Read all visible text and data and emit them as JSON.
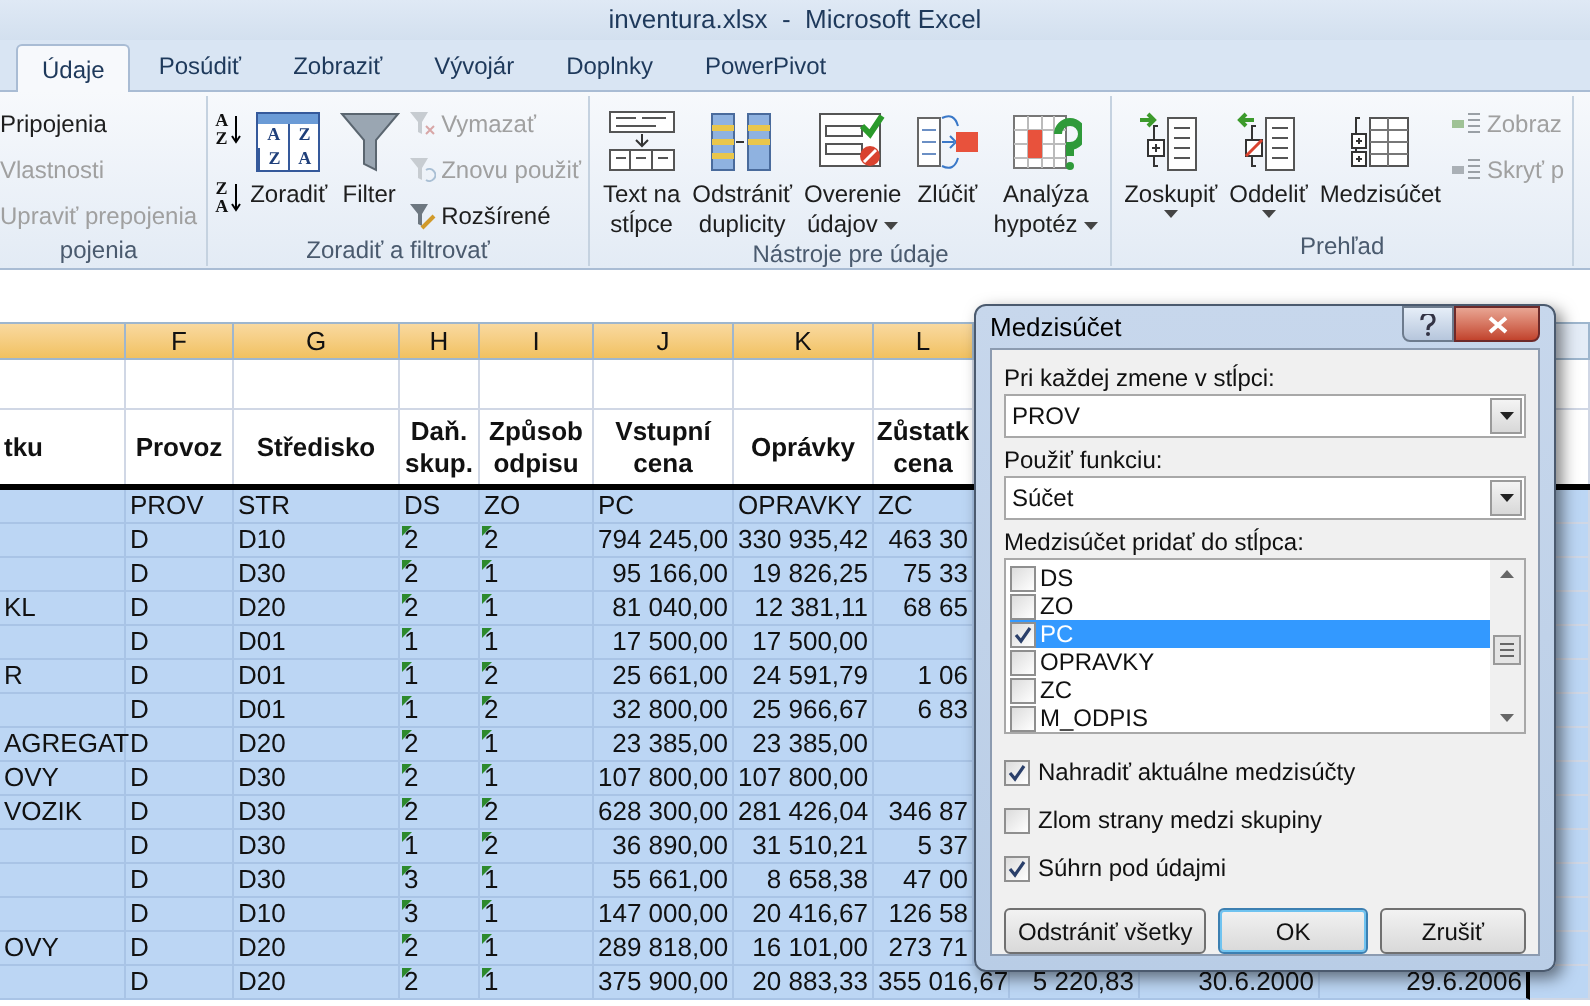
{
  "window": {
    "title": "inventura.xlsx  -  Microsoft Excel"
  },
  "tabs": [
    {
      "label": "Údaje",
      "selected": true
    },
    {
      "label": "Posúdiť",
      "selected": false
    },
    {
      "label": "Zobraziť",
      "selected": false
    },
    {
      "label": "Vývojár",
      "selected": false
    },
    {
      "label": "Doplnky",
      "selected": false
    },
    {
      "label": "PowerPivot",
      "selected": false
    }
  ],
  "ribbon": {
    "groups": [
      {
        "label": "pojenia",
        "items": [
          {
            "kind": "small",
            "label": "Pripojenia",
            "disabled": false
          },
          {
            "kind": "small",
            "label": "Vlastnosti",
            "disabled": true
          },
          {
            "kind": "small",
            "label": "Upraviť prepojenia",
            "disabled": true
          }
        ]
      },
      {
        "label": "Zoradiť a filtrovať",
        "items": [
          {
            "kind": "sort",
            "letters": [
              "A",
              "Z"
            ]
          },
          {
            "kind": "sort",
            "letters": [
              "Z",
              "A"
            ]
          },
          {
            "kind": "large",
            "lines": [
              "Zoradiť"
            ],
            "letters": [
              "A",
              "Z",
              "Z",
              "A"
            ],
            "dropdown": false
          },
          {
            "kind": "large",
            "lines": [
              "Filter"
            ],
            "dropdown": false
          },
          {
            "kind": "small",
            "label": "Vymazať",
            "disabled": true
          },
          {
            "kind": "small",
            "label": "Znovu použiť",
            "disabled": true
          },
          {
            "kind": "small",
            "label": "Rozšírené",
            "disabled": false
          }
        ]
      },
      {
        "label": "Nástroje pre údaje",
        "items": [
          {
            "kind": "large",
            "lines": [
              "Text na",
              "stĺpce"
            ],
            "dropdown": false
          },
          {
            "kind": "large",
            "lines": [
              "Odstrániť",
              "duplicity"
            ],
            "dropdown": false
          },
          {
            "kind": "large",
            "lines": [
              "Overenie",
              "údajov"
            ],
            "dropdown": true
          },
          {
            "kind": "large",
            "lines": [
              "Zlúčiť"
            ],
            "dropdown": false
          },
          {
            "kind": "large",
            "lines": [
              "Analýza",
              "hypotéz"
            ],
            "dropdown": true
          }
        ]
      },
      {
        "label": "Prehľad",
        "items": [
          {
            "kind": "large",
            "lines": [
              "Zoskupiť"
            ],
            "dropdown": true
          },
          {
            "kind": "large",
            "lines": [
              "Oddeliť"
            ],
            "dropdown": true
          },
          {
            "kind": "large",
            "lines": [
              "Medzisúčet"
            ],
            "dropdown": false
          },
          {
            "kind": "small",
            "label": "Zobraz",
            "disabled": true
          },
          {
            "kind": "small",
            "label": "Skryť p",
            "disabled": true
          }
        ]
      }
    ]
  },
  "sheet": {
    "column_letters": [
      "F",
      "G",
      "H",
      "I",
      "J",
      "K",
      "L"
    ],
    "header": [
      "tku",
      "Provoz",
      "Středisko",
      "Daň. skup.",
      "Způsob odpisu",
      "Vstupní cena",
      "Oprávky",
      "Zůstatk cena"
    ],
    "rows": [
      {
        "selected": true,
        "cells": [
          "",
          "PROV",
          "STR",
          "DS",
          "ZO",
          "PC",
          "OPRAVKY",
          "ZC"
        ]
      },
      {
        "selected": true,
        "cells": [
          "",
          "D",
          "D10",
          "2",
          "2",
          "794 245,00",
          "330 935,42",
          "463 30"
        ]
      },
      {
        "selected": true,
        "cells": [
          "",
          "D",
          "D30",
          "2",
          "1",
          "95 166,00",
          "19 826,25",
          "75 33"
        ]
      },
      {
        "selected": true,
        "cells": [
          "KL",
          "D",
          "D20",
          "2",
          "1",
          "81 040,00",
          "12 381,11",
          "68 65"
        ]
      },
      {
        "selected": true,
        "cells": [
          "",
          "D",
          "D01",
          "1",
          "1",
          "17 500,00",
          "17 500,00",
          ""
        ]
      },
      {
        "selected": true,
        "cells": [
          "R",
          "D",
          "D01",
          "1",
          "2",
          "25 661,00",
          "24 591,79",
          "1 06"
        ]
      },
      {
        "selected": true,
        "cells": [
          "",
          "D",
          "D01",
          "1",
          "2",
          "32 800,00",
          "25 966,67",
          "6 83"
        ]
      },
      {
        "selected": true,
        "cells": [
          "AGREGAT",
          "D",
          "D20",
          "2",
          "1",
          "23 385,00",
          "23 385,00",
          ""
        ]
      },
      {
        "selected": true,
        "cells": [
          "OVY",
          "D",
          "D30",
          "2",
          "1",
          "107 800,00",
          "107 800,00",
          ""
        ]
      },
      {
        "selected": true,
        "cells": [
          "VOZIK",
          "D",
          "D30",
          "2",
          "2",
          "628 300,00",
          "281 426,04",
          "346 87"
        ]
      },
      {
        "selected": true,
        "cells": [
          "",
          "D",
          "D30",
          "1",
          "2",
          "36 890,00",
          "31 510,21",
          "5 37"
        ]
      },
      {
        "selected": true,
        "cells": [
          "",
          "D",
          "D30",
          "3",
          "1",
          "55 661,00",
          "8 658,38",
          "47 00"
        ]
      },
      {
        "selected": true,
        "cells": [
          "",
          "D",
          "D10",
          "3",
          "1",
          "147 000,00",
          "20 416,67",
          "126 58"
        ]
      },
      {
        "selected": true,
        "cells": [
          "OVY",
          "D",
          "D20",
          "2",
          "1",
          "289 818,00",
          "16 101,00",
          "273 71"
        ]
      },
      {
        "selected": true,
        "cells": [
          "",
          "D",
          "D20",
          "2",
          "1",
          "375 900,00",
          "20 883,33",
          "355 016,67",
          "5 220,83",
          "30.6.2000",
          "29.6.2006"
        ]
      }
    ]
  },
  "dialog": {
    "title": "Medzisúčet",
    "label_column": "Pri každej zmene v stĺpci:",
    "column_value": "PROV",
    "label_function": "Použiť funkciu:",
    "function_value": "Súčet",
    "label_add": "Medzisúčet pridať do stĺpca:",
    "list": [
      {
        "label": "DS",
        "checked": false,
        "selected": false
      },
      {
        "label": "ZO",
        "checked": false,
        "selected": false
      },
      {
        "label": "PC",
        "checked": true,
        "selected": true
      },
      {
        "label": "OPRAVKY",
        "checked": false,
        "selected": false
      },
      {
        "label": "ZC",
        "checked": false,
        "selected": false
      },
      {
        "label": "M_ODPIS",
        "checked": false,
        "selected": false
      }
    ],
    "options": [
      {
        "label": "Nahradiť aktuálne medzisúčty",
        "checked": true
      },
      {
        "label": "Zlom strany medzi skupiny",
        "checked": false
      },
      {
        "label": "Súhrn pod údajmi",
        "checked": true
      }
    ],
    "buttons": [
      {
        "label": "Odstrániť všetky",
        "default": false
      },
      {
        "label": "OK",
        "default": true
      },
      {
        "label": "Zrušiť",
        "default": false
      }
    ]
  }
}
